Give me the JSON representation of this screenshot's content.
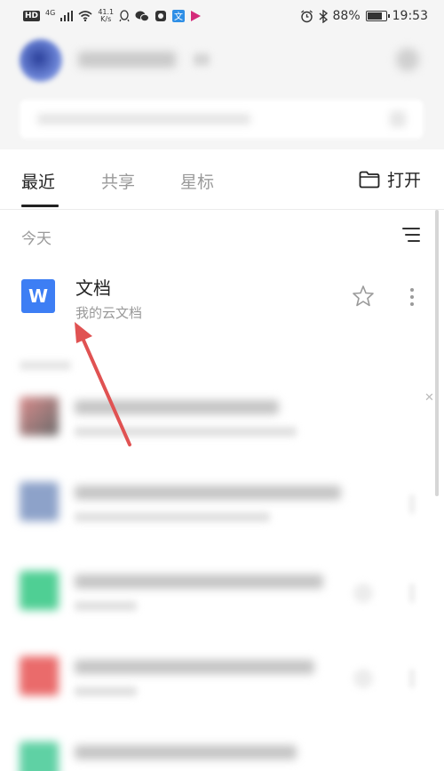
{
  "status_bar": {
    "hd": "HD",
    "network_type": "4G",
    "speed_value": "41.1",
    "speed_unit": "K/s",
    "battery_percent": "88%",
    "battery_level": 0.88,
    "time": "19:53"
  },
  "tabs": [
    {
      "label": "最近",
      "active": true
    },
    {
      "label": "共享",
      "active": false
    },
    {
      "label": "星标",
      "active": false
    }
  ],
  "open_button": {
    "label": "打开"
  },
  "section": {
    "title": "今天"
  },
  "document": {
    "icon_letter": "W",
    "title": "文档",
    "subtitle": "我的云文档"
  },
  "colors": {
    "doc_icon": "#3d7ef4",
    "annotation_arrow": "#e05252",
    "accent_text": "#222222"
  },
  "icons": {
    "folder": "folder-icon",
    "sort": "sort-icon",
    "star": "star-icon",
    "more": "more-vertical-icon",
    "close": "close-icon"
  }
}
